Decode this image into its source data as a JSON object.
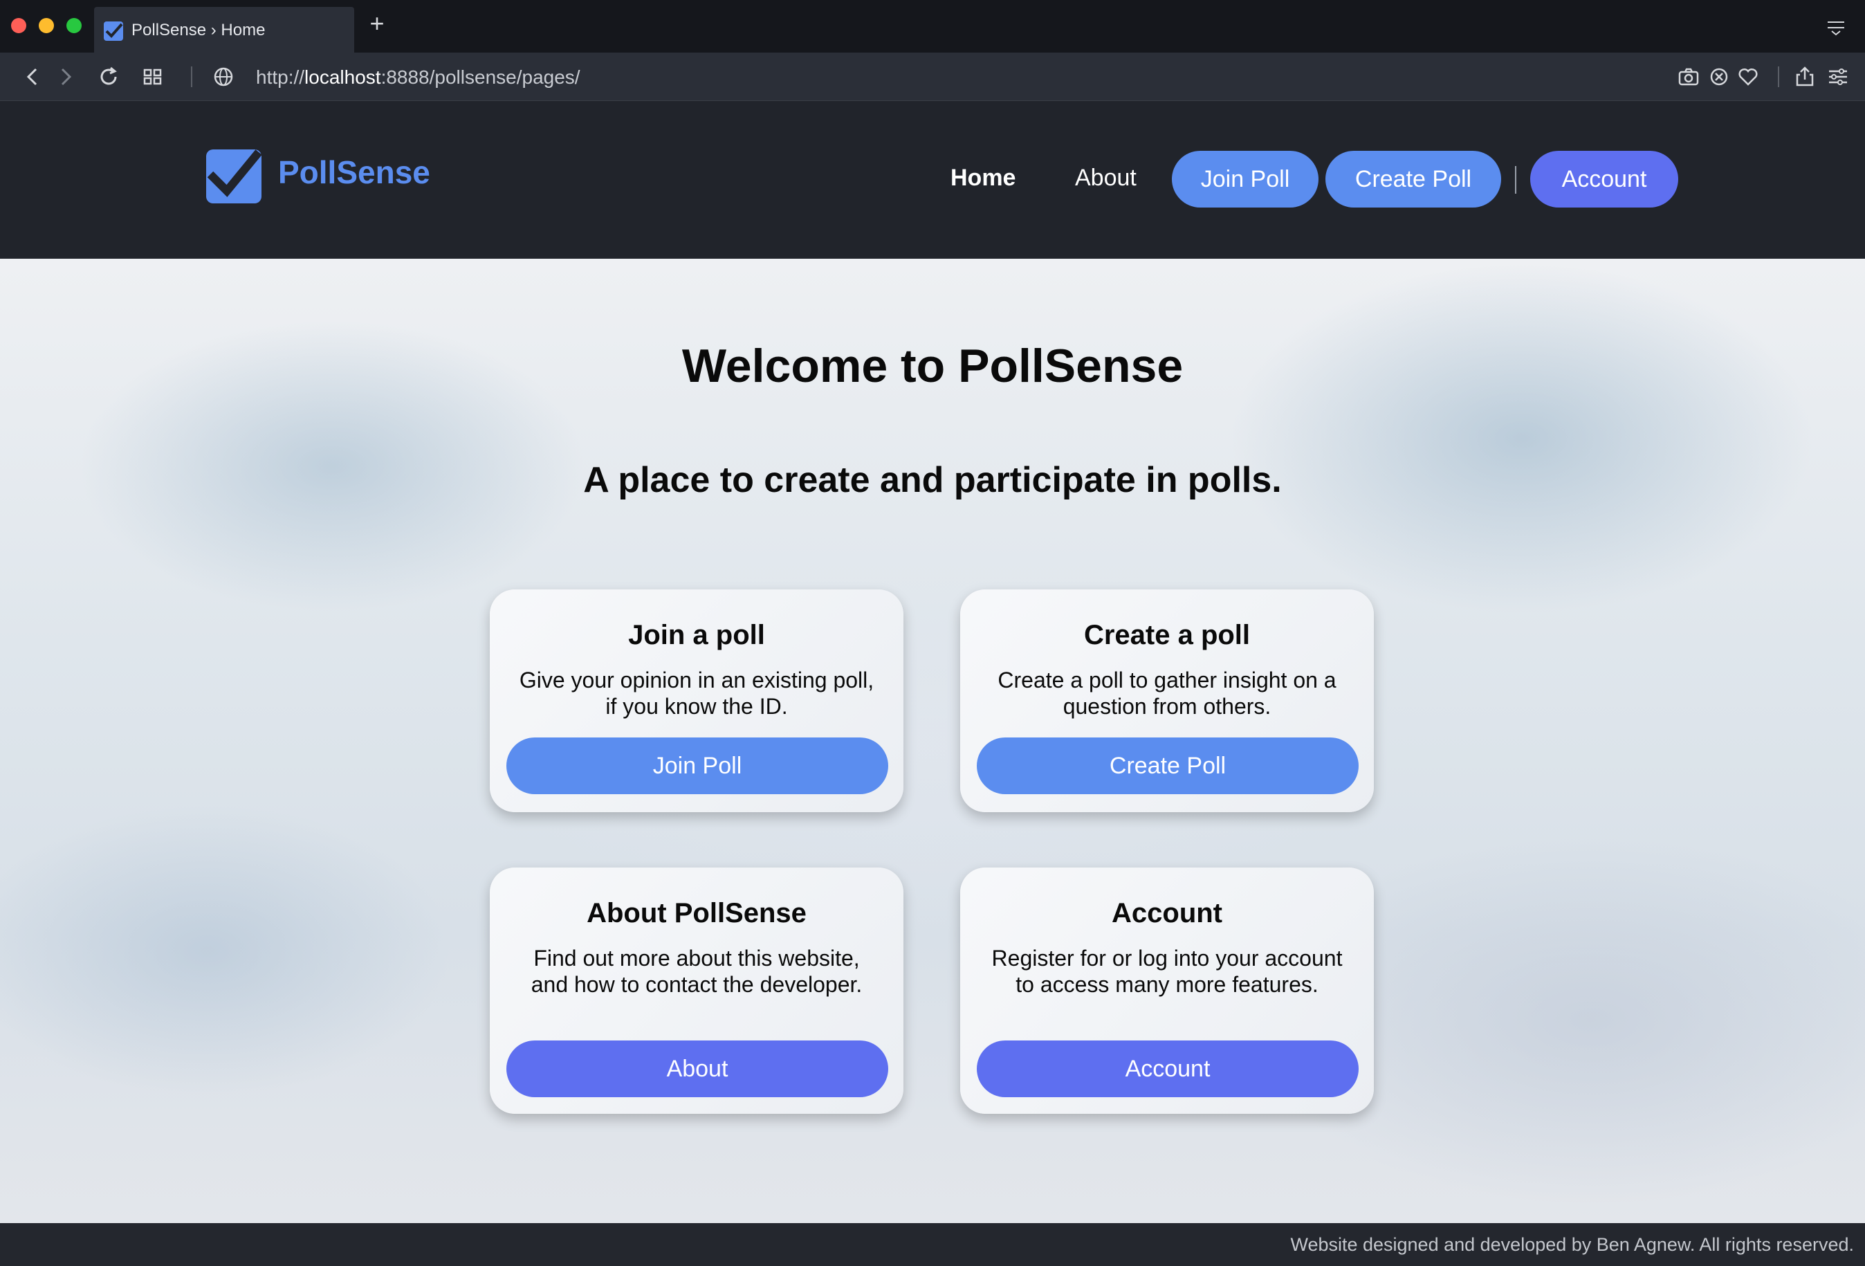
{
  "browser": {
    "tab_title": "PollSense › Home",
    "new_tab_label": "+",
    "url_prefix": "http://",
    "url_host": "localhost",
    "url_rest": ":8888/pollsense/pages/"
  },
  "header": {
    "brand": "PollSense",
    "nav": {
      "home": "Home",
      "about": "About",
      "join_poll": "Join Poll",
      "create_poll": "Create Poll",
      "account": "Account"
    }
  },
  "hero": {
    "title": "Welcome to PollSense",
    "subtitle": "A place to create and participate in polls."
  },
  "cards": [
    {
      "title": "Join a poll",
      "description": "Give your opinion in an existing poll, if you know the ID.",
      "button": "Join Poll"
    },
    {
      "title": "Create a poll",
      "description": "Create a poll to gather insight on a question from others.",
      "button": "Create Poll"
    },
    {
      "title": "About PollSense",
      "description": "Find out more about this website, and how to contact the developer.",
      "button": "About"
    },
    {
      "title": "Account",
      "description": "Register for or log into your account to access many more features.",
      "button": "Account"
    }
  ],
  "footer": {
    "text": "Website designed and developed by Ben Agnew. All rights reserved."
  },
  "colors": {
    "brand_blue": "#5b8def",
    "accent_indigo": "#5e6ff0",
    "header_bg": "#21242b"
  },
  "icons": {
    "logo": "checkbox-check-icon",
    "back": "back-arrow-icon",
    "forward": "forward-arrow-icon",
    "reload": "reload-icon",
    "tabs_grid": "grid-icon",
    "globe": "globe-icon",
    "camera": "camera-icon",
    "block": "block-icon",
    "heart": "heart-icon",
    "share": "share-icon",
    "settings": "sliders-icon"
  }
}
